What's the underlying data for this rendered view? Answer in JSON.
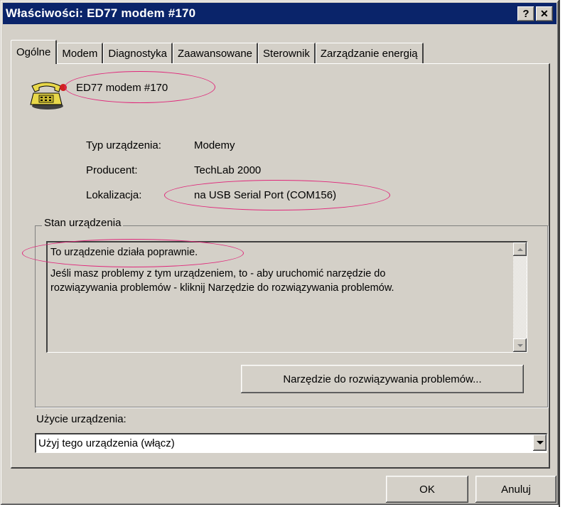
{
  "window": {
    "title": "Właściwości: ED77 modem #170",
    "help_label": "?",
    "close_label": "✕"
  },
  "tabs": [
    {
      "label": "Ogólne"
    },
    {
      "label": "Modem"
    },
    {
      "label": "Diagnostyka"
    },
    {
      "label": "Zaawansowane"
    },
    {
      "label": "Sterownik"
    },
    {
      "label": "Zarządzanie energią"
    }
  ],
  "device": {
    "icon": "telephone-icon",
    "name": "ED77 modem #170",
    "type_label": "Typ urządzenia:",
    "type_value": "Modemy",
    "manufacturer_label": "Producent:",
    "manufacturer_value": "TechLab 2000",
    "location_label": "Lokalizacja:",
    "location_value": "na USB Serial Port (COM156)"
  },
  "status": {
    "group_label": "Stan urządzenia",
    "line1": "To urządzenie działa poprawnie.",
    "line2": "Jeśli masz problemy z tym urządzeniem, to - aby uruchomić narzędzie do",
    "line3": "rozwiązywania problemów - kliknij Narzędzie do rozwiązywania problemów.",
    "troubleshoot_button": "Narzędzie do rozwiązywania problemów..."
  },
  "usage": {
    "label": "Użycie urządzenia:",
    "selected": "Użyj tego urządzenia (włącz)"
  },
  "buttons": {
    "ok": "OK",
    "cancel": "Anuluj"
  },
  "colors": {
    "titlebar": "#0a246a",
    "face": "#d4d0c8",
    "annotation": "#e0277a"
  }
}
